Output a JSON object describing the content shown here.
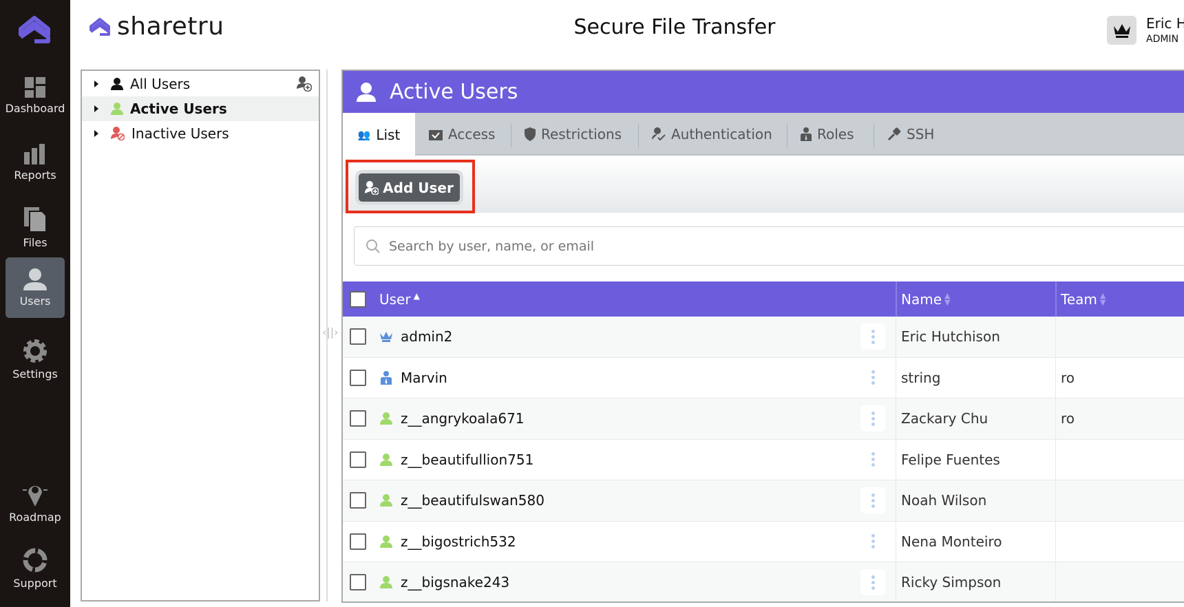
{
  "app": {
    "brand": "sharetru",
    "title": "Secure File Transfer",
    "accent": "#6c5ddc"
  },
  "user": {
    "name": "Eric H",
    "role": "ADMIN",
    "avatar_icon": "crown-icon"
  },
  "sidebar": {
    "items": [
      {
        "label": "Dashboard",
        "icon": "dashboard-icon"
      },
      {
        "label": "Reports",
        "icon": "bar-chart-icon"
      },
      {
        "label": "Files",
        "icon": "files-icon"
      },
      {
        "label": "Users",
        "icon": "user-icon",
        "active": true
      },
      {
        "label": "Settings",
        "icon": "gear-icon"
      },
      {
        "label": "Roadmap",
        "icon": "map-pin-icon"
      },
      {
        "label": "Support",
        "icon": "lifebuoy-icon"
      }
    ]
  },
  "tree": {
    "items": [
      {
        "label": "All Users",
        "icon": "user-icon"
      },
      {
        "label": "Active Users",
        "icon": "user-active-icon",
        "selected": true
      },
      {
        "label": "Inactive Users",
        "icon": "user-inactive-icon"
      }
    ]
  },
  "panel": {
    "title": "Active Users",
    "tabs": [
      {
        "label": "List"
      },
      {
        "label": "Access"
      },
      {
        "label": "Restrictions"
      },
      {
        "label": "Authentication"
      },
      {
        "label": "Roles"
      },
      {
        "label": "SSH"
      }
    ],
    "add_user_label": "Add User",
    "search_placeholder": "Search by user, name, or email"
  },
  "table": {
    "columns": [
      {
        "label": "User",
        "sort": "asc"
      },
      {
        "label": "Name",
        "sort": "none"
      },
      {
        "label": "Team",
        "sort": "none"
      }
    ],
    "rows": [
      {
        "user": "admin2",
        "type": "admin",
        "name": "Eric Hutchison",
        "team": ""
      },
      {
        "user": "Marvin",
        "type": "role",
        "name": "string",
        "team": "ro"
      },
      {
        "user": "z__angrykoala671",
        "type": "active",
        "name": "Zackary Chu",
        "team": "ro"
      },
      {
        "user": "z__beautifullion751",
        "type": "active",
        "name": "Felipe Fuentes",
        "team": ""
      },
      {
        "user": "z__beautifulswan580",
        "type": "active",
        "name": "Noah Wilson",
        "team": ""
      },
      {
        "user": "z__bigostrich532",
        "type": "active",
        "name": "Nena Monteiro",
        "team": ""
      },
      {
        "user": "z__bigsnake243",
        "type": "active",
        "name": "Ricky Simpson",
        "team": ""
      }
    ]
  }
}
